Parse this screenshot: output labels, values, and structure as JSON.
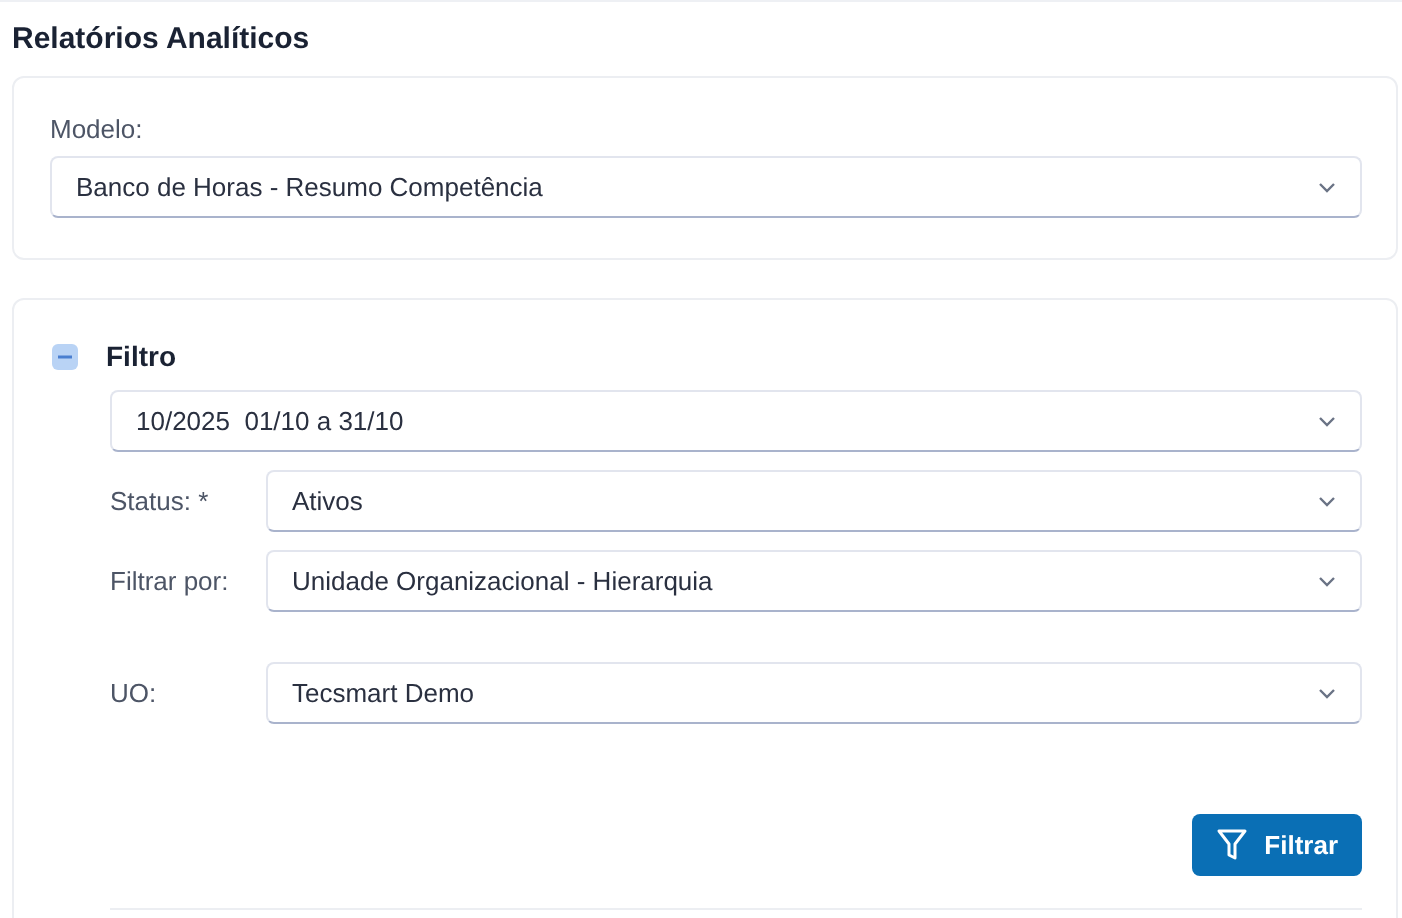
{
  "title": "Relatórios Analíticos",
  "model": {
    "label": "Modelo:",
    "value": "Banco de Horas - Resumo Competência"
  },
  "filter": {
    "title": "Filtro",
    "expanded": true,
    "period": {
      "value": "10/2025  01/10 a 31/10"
    },
    "fields": [
      {
        "label": "Status:",
        "required_mark": "*",
        "value": "Ativos"
      },
      {
        "label": "Filtrar por:",
        "value": "Unidade Organizacional - Hierarquia"
      },
      {
        "label": "UO:",
        "value": "Tecsmart Demo"
      }
    ],
    "button": "Filtrar"
  }
}
